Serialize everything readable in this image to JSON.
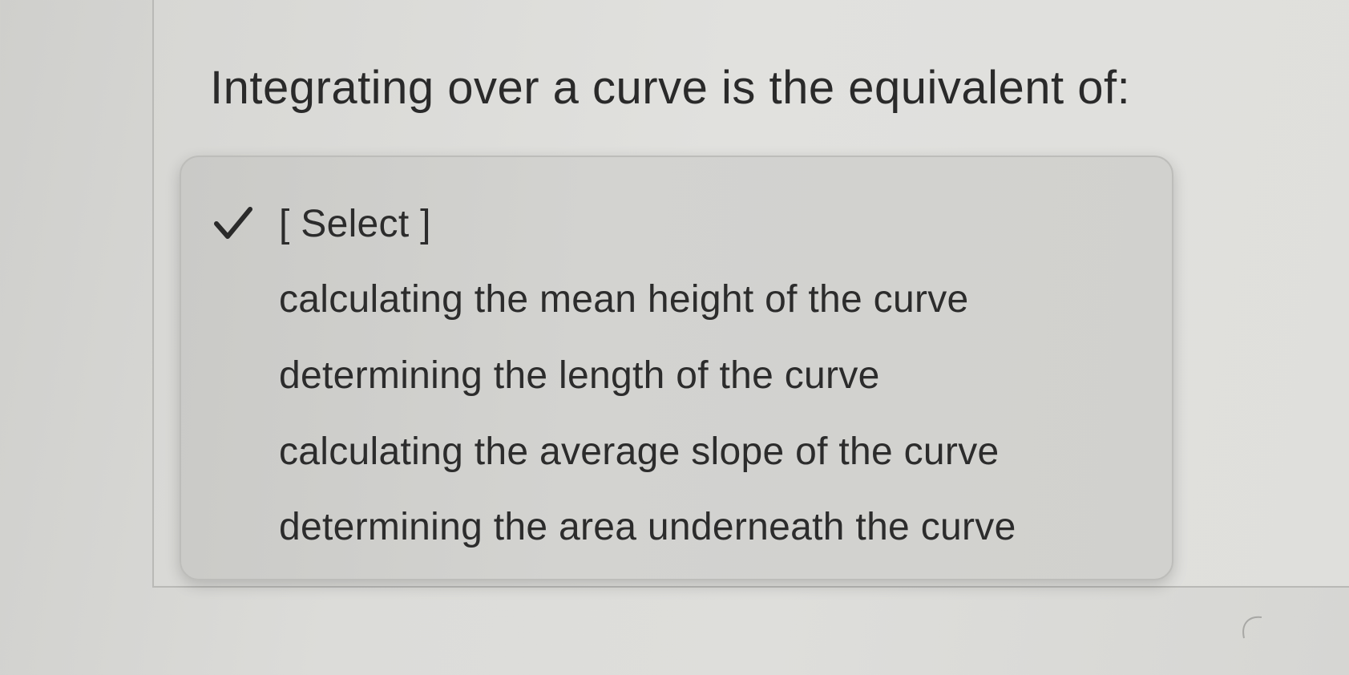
{
  "question": {
    "text": "Integrating over a curve is the equivalent of:"
  },
  "dropdown": {
    "selected_index": 0,
    "options": [
      {
        "label": "[ Select ]",
        "selected": true,
        "icon": "checkmark-icon"
      },
      {
        "label": "calculating the mean height of the curve",
        "selected": false
      },
      {
        "label": "determining the length of the curve",
        "selected": false
      },
      {
        "label": "calculating the average slope of the curve",
        "selected": false
      },
      {
        "label": "determining the area underneath the curve",
        "selected": false
      }
    ]
  }
}
